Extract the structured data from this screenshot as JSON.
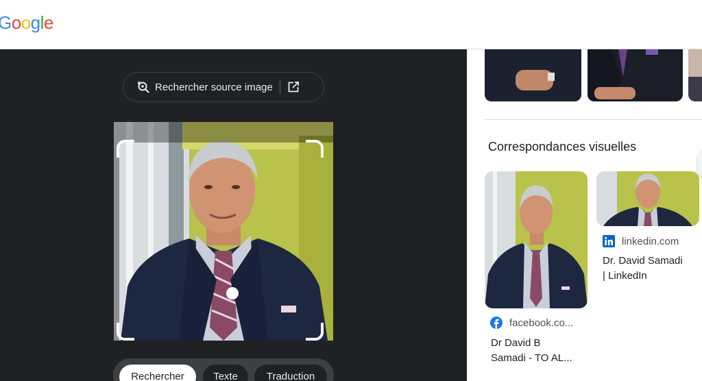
{
  "header": {
    "logo_text": "Google"
  },
  "lens_panel": {
    "source_button_label": "Rechercher source image",
    "modes": [
      {
        "label": "Rechercher",
        "active": true
      },
      {
        "label": "Texte",
        "active": false
      },
      {
        "label": "Traduction",
        "active": false
      }
    ]
  },
  "results": {
    "section_title": "Correspondances visuelles",
    "cards": [
      {
        "source": "facebook.co...",
        "source_icon": "facebook-icon",
        "title_line1": "Dr David B",
        "title_line2": "Samadi - TO AL..."
      },
      {
        "source": "linkedin.com",
        "source_icon": "linkedin-icon",
        "title_line1": "Dr. David Samadi",
        "title_line2": "| LinkedIn"
      }
    ]
  },
  "colors": {
    "dark_bg": "#202124",
    "facebook": "#1877f2",
    "linkedin": "#0a66c2",
    "logo_blue": "#4285f4",
    "logo_red": "#ea4335",
    "logo_yellow": "#fbbc05",
    "logo_green": "#34a853"
  }
}
